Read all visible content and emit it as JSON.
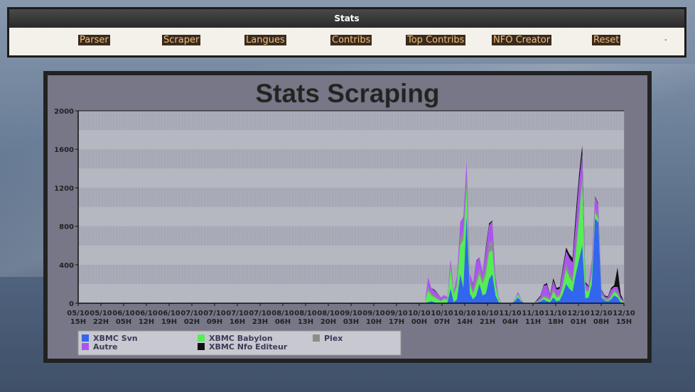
{
  "nav": {
    "title": "Stats",
    "links": [
      "Parser",
      "Scraper",
      "Langues",
      "Contribs",
      "Top Contribs",
      "NFO Creator",
      "Reset"
    ],
    "trailing": "-"
  },
  "colors": {
    "svn": "#3366ee",
    "babylon": "#55ee55",
    "plex": "#8c8c8c",
    "autre": "#aa55ee",
    "nfo": "#111111"
  },
  "chart_data": {
    "type": "area",
    "title": "Stats Scraping",
    "stacked": true,
    "ylim": [
      0,
      2000
    ],
    "yticks": [
      0,
      400,
      800,
      1200,
      1600,
      2000
    ],
    "grid": true,
    "legend_position": "bottom-left",
    "x_labels": [
      [
        "05/10",
        "15H"
      ],
      [
        "05/10",
        "22H"
      ],
      [
        "06/10",
        "05H"
      ],
      [
        "06/10",
        "12H"
      ],
      [
        "06/10",
        "19H"
      ],
      [
        "07/10",
        "02H"
      ],
      [
        "07/10",
        "09H"
      ],
      [
        "07/10",
        "16H"
      ],
      [
        "07/10",
        "23H"
      ],
      [
        "08/10",
        "06H"
      ],
      [
        "08/10",
        "13H"
      ],
      [
        "08/10",
        "20H"
      ],
      [
        "09/10",
        "03H"
      ],
      [
        "09/10",
        "10H"
      ],
      [
        "09/10",
        "17H"
      ],
      [
        "10/10",
        "00H"
      ],
      [
        "10/10",
        "07H"
      ],
      [
        "10/10",
        "14H"
      ],
      [
        "10/10",
        "21H"
      ],
      [
        "11/10",
        "04H"
      ],
      [
        "11/10",
        "11H"
      ],
      [
        "11/10",
        "18H"
      ],
      [
        "12/10",
        "01H"
      ],
      [
        "12/10",
        "08H"
      ],
      [
        "12/10",
        "15H"
      ]
    ],
    "series": [
      {
        "name": "XBMC Svn",
        "values": [
          0,
          0,
          0,
          0,
          0,
          0,
          0,
          0,
          0,
          0,
          0,
          0,
          0,
          0,
          0,
          0,
          0,
          0,
          0,
          0,
          0,
          0,
          0,
          0,
          0,
          0,
          0,
          0,
          0,
          0,
          0,
          0,
          0,
          0,
          0,
          0,
          0,
          0,
          0,
          0,
          0,
          0,
          0,
          0,
          0,
          0,
          0,
          0,
          0,
          0,
          0,
          0,
          0,
          0,
          0,
          0,
          0,
          0,
          0,
          0,
          0,
          0,
          0,
          0,
          0,
          0,
          0,
          0,
          0,
          0,
          0,
          0,
          0,
          0,
          0,
          0,
          0,
          0,
          0,
          0,
          0,
          0,
          0,
          0,
          0,
          0,
          0,
          0,
          0,
          0,
          0,
          0,
          0,
          0,
          0,
          0,
          0,
          0,
          0,
          0,
          0,
          0,
          0,
          0,
          0,
          0,
          0,
          0,
          0,
          10,
          20,
          10,
          0,
          0,
          5,
          5,
          150,
          10,
          40,
          300,
          160,
          900,
          100,
          40,
          80,
          200,
          80,
          100,
          250,
          300,
          80,
          10,
          0,
          0,
          0,
          0,
          20,
          60,
          20,
          0,
          0,
          0,
          0,
          10,
          20,
          40,
          20,
          10,
          60,
          20,
          30,
          100,
          200,
          150,
          120,
          300,
          450,
          600,
          50,
          60,
          200,
          880,
          840,
          60,
          30,
          20,
          40,
          80,
          60,
          10,
          0
        ]
      },
      {
        "name": "XBMC Babylon",
        "values": [
          0,
          0,
          0,
          0,
          0,
          0,
          0,
          0,
          0,
          0,
          0,
          0,
          0,
          0,
          0,
          0,
          0,
          0,
          0,
          0,
          0,
          0,
          0,
          0,
          0,
          0,
          0,
          0,
          0,
          0,
          0,
          0,
          0,
          0,
          0,
          0,
          0,
          0,
          0,
          0,
          0,
          0,
          0,
          0,
          0,
          0,
          0,
          0,
          0,
          0,
          0,
          0,
          0,
          0,
          0,
          0,
          0,
          0,
          0,
          0,
          0,
          0,
          0,
          0,
          0,
          0,
          0,
          0,
          0,
          0,
          0,
          0,
          0,
          0,
          0,
          0,
          0,
          0,
          0,
          0,
          0,
          0,
          0,
          0,
          0,
          0,
          0,
          0,
          0,
          0,
          0,
          0,
          0,
          0,
          0,
          0,
          0,
          0,
          0,
          0,
          0,
          0,
          0,
          0,
          0,
          0,
          0,
          0,
          0,
          120,
          60,
          50,
          40,
          20,
          40,
          30,
          200,
          80,
          140,
          300,
          500,
          300,
          90,
          60,
          120,
          100,
          120,
          200,
          280,
          250,
          100,
          30,
          0,
          0,
          0,
          0,
          10,
          30,
          10,
          0,
          0,
          0,
          0,
          5,
          10,
          20,
          30,
          20,
          60,
          40,
          40,
          80,
          150,
          120,
          100,
          200,
          400,
          650,
          80,
          60,
          100,
          60,
          40,
          20,
          10,
          10,
          20,
          40,
          30,
          20,
          10
        ]
      },
      {
        "name": "Plex",
        "values": [
          0,
          0,
          0,
          0,
          0,
          0,
          0,
          0,
          0,
          0,
          0,
          0,
          0,
          0,
          0,
          0,
          0,
          0,
          0,
          0,
          0,
          0,
          0,
          0,
          0,
          0,
          0,
          0,
          0,
          0,
          0,
          0,
          0,
          0,
          0,
          0,
          0,
          0,
          0,
          0,
          0,
          0,
          0,
          0,
          0,
          0,
          0,
          0,
          0,
          0,
          0,
          0,
          0,
          0,
          0,
          0,
          0,
          0,
          0,
          0,
          0,
          0,
          0,
          0,
          0,
          0,
          0,
          0,
          0,
          0,
          0,
          0,
          0,
          0,
          0,
          0,
          0,
          0,
          0,
          0,
          0,
          0,
          0,
          0,
          0,
          0,
          0,
          0,
          0,
          0,
          0,
          0,
          0,
          0,
          0,
          0,
          0,
          0,
          0,
          0,
          0,
          0,
          0,
          0,
          0,
          0,
          0,
          0,
          0,
          40,
          20,
          20,
          15,
          10,
          10,
          10,
          50,
          20,
          40,
          80,
          80,
          100,
          40,
          30,
          50,
          60,
          40,
          80,
          100,
          100,
          40,
          10,
          0,
          0,
          0,
          0,
          5,
          10,
          5,
          0,
          0,
          0,
          0,
          5,
          10,
          20,
          20,
          10,
          30,
          20,
          20,
          40,
          60,
          50,
          50,
          80,
          100,
          100,
          30,
          20,
          60,
          40,
          40,
          20,
          10,
          10,
          20,
          20,
          20,
          10,
          5
        ]
      },
      {
        "name": "Autre",
        "values": [
          0,
          0,
          0,
          0,
          0,
          0,
          0,
          0,
          0,
          0,
          0,
          0,
          0,
          0,
          0,
          0,
          0,
          0,
          0,
          0,
          0,
          0,
          0,
          0,
          0,
          0,
          0,
          0,
          0,
          0,
          0,
          0,
          0,
          0,
          0,
          0,
          0,
          0,
          0,
          0,
          0,
          0,
          0,
          0,
          0,
          0,
          0,
          0,
          0,
          0,
          0,
          0,
          0,
          0,
          0,
          0,
          0,
          0,
          0,
          0,
          0,
          0,
          0,
          0,
          0,
          0,
          0,
          0,
          0,
          0,
          0,
          0,
          0,
          0,
          0,
          0,
          0,
          0,
          0,
          0,
          0,
          0,
          0,
          0,
          0,
          0,
          0,
          0,
          0,
          0,
          0,
          0,
          0,
          0,
          0,
          0,
          0,
          0,
          0,
          0,
          0,
          0,
          0,
          0,
          0,
          0,
          0,
          0,
          0,
          100,
          60,
          50,
          40,
          30,
          30,
          20,
          60,
          20,
          60,
          160,
          160,
          180,
          80,
          60,
          180,
          120,
          80,
          180,
          180,
          200,
          60,
          10,
          0,
          0,
          0,
          0,
          5,
          20,
          5,
          0,
          0,
          0,
          0,
          10,
          30,
          100,
          120,
          40,
          80,
          60,
          60,
          130,
          130,
          150,
          150,
          250,
          300,
          200,
          40,
          30,
          90,
          120,
          110,
          30,
          20,
          20,
          60,
          30,
          60,
          20,
          10
        ]
      },
      {
        "name": "XBMC Nfo Editeur",
        "values": [
          0,
          0,
          0,
          0,
          0,
          0,
          0,
          0,
          0,
          0,
          0,
          0,
          0,
          0,
          0,
          0,
          0,
          0,
          0,
          0,
          0,
          0,
          0,
          0,
          0,
          0,
          0,
          0,
          0,
          0,
          0,
          0,
          0,
          0,
          0,
          0,
          0,
          0,
          0,
          0,
          0,
          0,
          0,
          0,
          0,
          0,
          0,
          0,
          0,
          0,
          0,
          0,
          0,
          0,
          0,
          0,
          0,
          0,
          0,
          0,
          0,
          0,
          0,
          0,
          0,
          0,
          0,
          0,
          0,
          0,
          0,
          0,
          0,
          0,
          0,
          0,
          0,
          0,
          0,
          0,
          0,
          0,
          0,
          0,
          0,
          0,
          0,
          0,
          0,
          0,
          0,
          0,
          0,
          0,
          0,
          0,
          0,
          0,
          0,
          0,
          0,
          0,
          0,
          0,
          0,
          0,
          0,
          0,
          0,
          0,
          0,
          10,
          5,
          0,
          0,
          0,
          0,
          0,
          0,
          0,
          0,
          0,
          0,
          10,
          10,
          0,
          0,
          30,
          20,
          10,
          0,
          0,
          0,
          0,
          0,
          0,
          0,
          0,
          0,
          0,
          0,
          0,
          0,
          10,
          10,
          10,
          20,
          10,
          30,
          20,
          20,
          30,
          40,
          40,
          50,
          100,
          80,
          90,
          20,
          10,
          0,
          10,
          10,
          10,
          10,
          10,
          20,
          20,
          200,
          30,
          0
        ]
      }
    ]
  }
}
